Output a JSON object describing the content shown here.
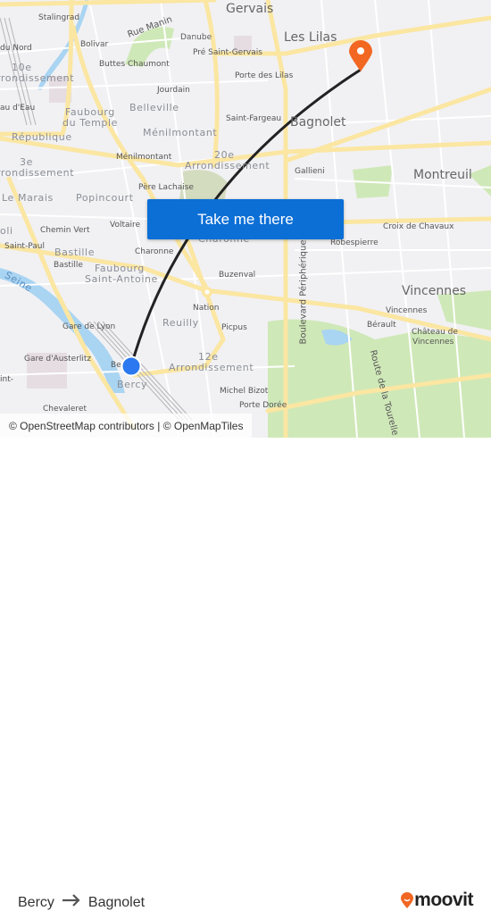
{
  "map": {
    "labels": [
      "Stalingrad",
      "Rue Manin",
      "Bolivar",
      "Danube",
      "Pré Saint-Gervais",
      "du Nord",
      "10e",
      "rrondissement",
      "Buttes Chaumont",
      "Jourdain",
      "Porte des Lilas",
      "Gervais",
      "Les Lilas",
      "Bagnolet",
      "Belleville",
      "au d'Eau",
      "Faubourg",
      "du Temple",
      "Ménilmontant",
      "Saint-Fargeau",
      "République",
      "3e",
      "rrondissement",
      "Ménilmontant",
      "20e",
      "Arrondissement",
      "Gallieni",
      "Montreuil",
      "Père Lachaise",
      "Le Marais",
      "Popincourt",
      "oli",
      "Chemin Vert",
      "Voltaire",
      "Croix de Chavaux",
      "Robespierre",
      "Saint-Paul",
      "Bastille",
      "Charonne",
      "Bastille",
      "Faubourg",
      "Saint-Antoine",
      "Buzenval",
      "Seine",
      "Vincennes",
      "Nation",
      "Vincennes",
      "Reuilly",
      "Gare de Lyon",
      "Bérault",
      "Picpus",
      "Château de",
      "Vincennes",
      "Gare d'Austerlitz",
      "12e",
      "Arrondissement",
      "Boulevard Périphérique",
      "Route de la Tourelle",
      "Bercy",
      "Michel Bizot",
      "Porte Dorée",
      "Chevaleret",
      "Charonne",
      "int-",
      "Be"
    ],
    "origin_marker": "blue-location-dot",
    "destination_marker": "orange-pin-icon",
    "route_color": "#222222",
    "attribution": "© OpenStreetMap contributors | © OpenMapTiles"
  },
  "cta": {
    "label": "Take me there",
    "color": "#0b6fd6"
  },
  "footer": {
    "from": "Bercy",
    "arrow_icon": "arrow-right-icon",
    "to": "Bagnolet",
    "brand": "moovit",
    "brand_color": "#f26722"
  }
}
